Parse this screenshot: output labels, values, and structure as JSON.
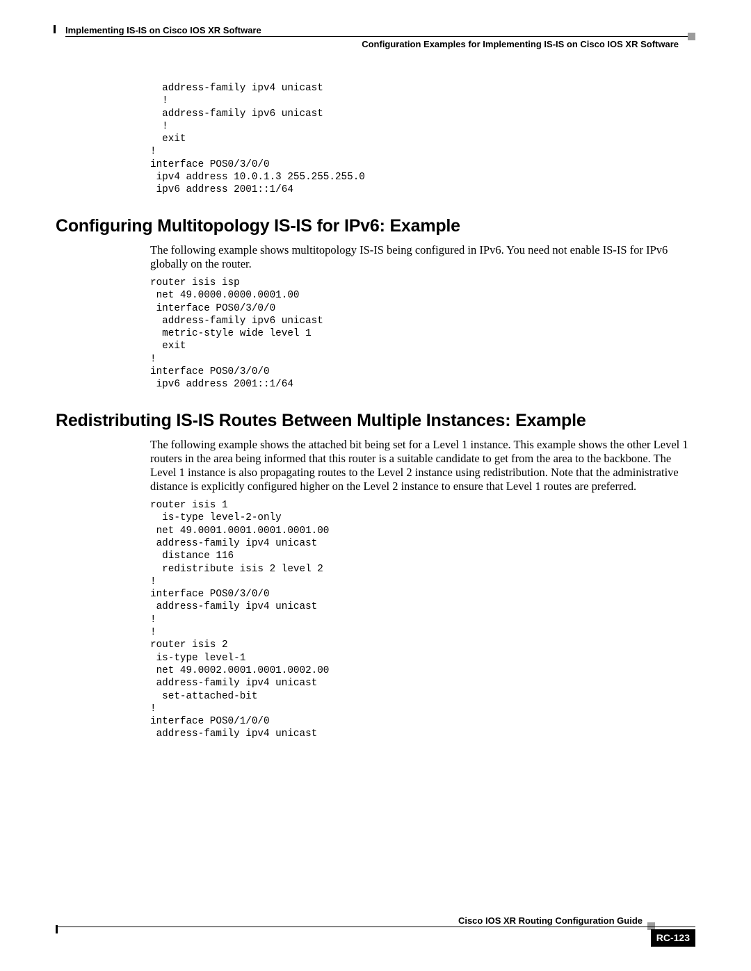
{
  "header": {
    "left": "Implementing IS-IS on Cisco IOS XR Software",
    "right": "Configuration Examples for Implementing IS-IS on Cisco IOS XR Software"
  },
  "code1": "  address-family ipv4 unicast\n  !\n  address-family ipv6 unicast\n  !\n  exit\n!\ninterface POS0/3/0/0\n ipv4 address 10.0.1.3 255.255.255.0\n ipv6 address 2001::1/64",
  "section1": {
    "heading": "Configuring Multitopology IS-IS for IPv6: Example",
    "para": "The following example shows multitopology IS-IS being configured in IPv6. You need not enable IS-IS for IPv6 globally on the router.",
    "code": "router isis isp\n net 49.0000.0000.0001.00\n interface POS0/3/0/0\n  address-family ipv6 unicast\n  metric-style wide level 1\n  exit\n!\ninterface POS0/3/0/0\n ipv6 address 2001::1/64"
  },
  "section2": {
    "heading": "Redistributing IS-IS Routes Between Multiple Instances: Example",
    "para": "The following example shows the attached bit being set for a Level 1 instance. This example shows the other Level 1 routers in the area being informed that this router is a suitable candidate to get from the area to the backbone. The Level 1 instance is also propagating routes to the Level 2 instance using redistribution. Note that the administrative distance is explicitly configured higher on the Level 2 instance to ensure that Level 1 routes are preferred.",
    "code": "router isis 1\n  is-type level-2-only\n net 49.0001.0001.0001.0001.00\n address-family ipv4 unicast\n  distance 116\n  redistribute isis 2 level 2\n!\ninterface POS0/3/0/0\n address-family ipv4 unicast\n!\n!\nrouter isis 2\n is-type level-1\n net 49.0002.0001.0001.0002.00\n address-family ipv4 unicast\n  set-attached-bit\n!\ninterface POS0/1/0/0\n address-family ipv4 unicast"
  },
  "footer": {
    "guide": "Cisco IOS XR Routing Configuration Guide",
    "page": "RC-123"
  }
}
